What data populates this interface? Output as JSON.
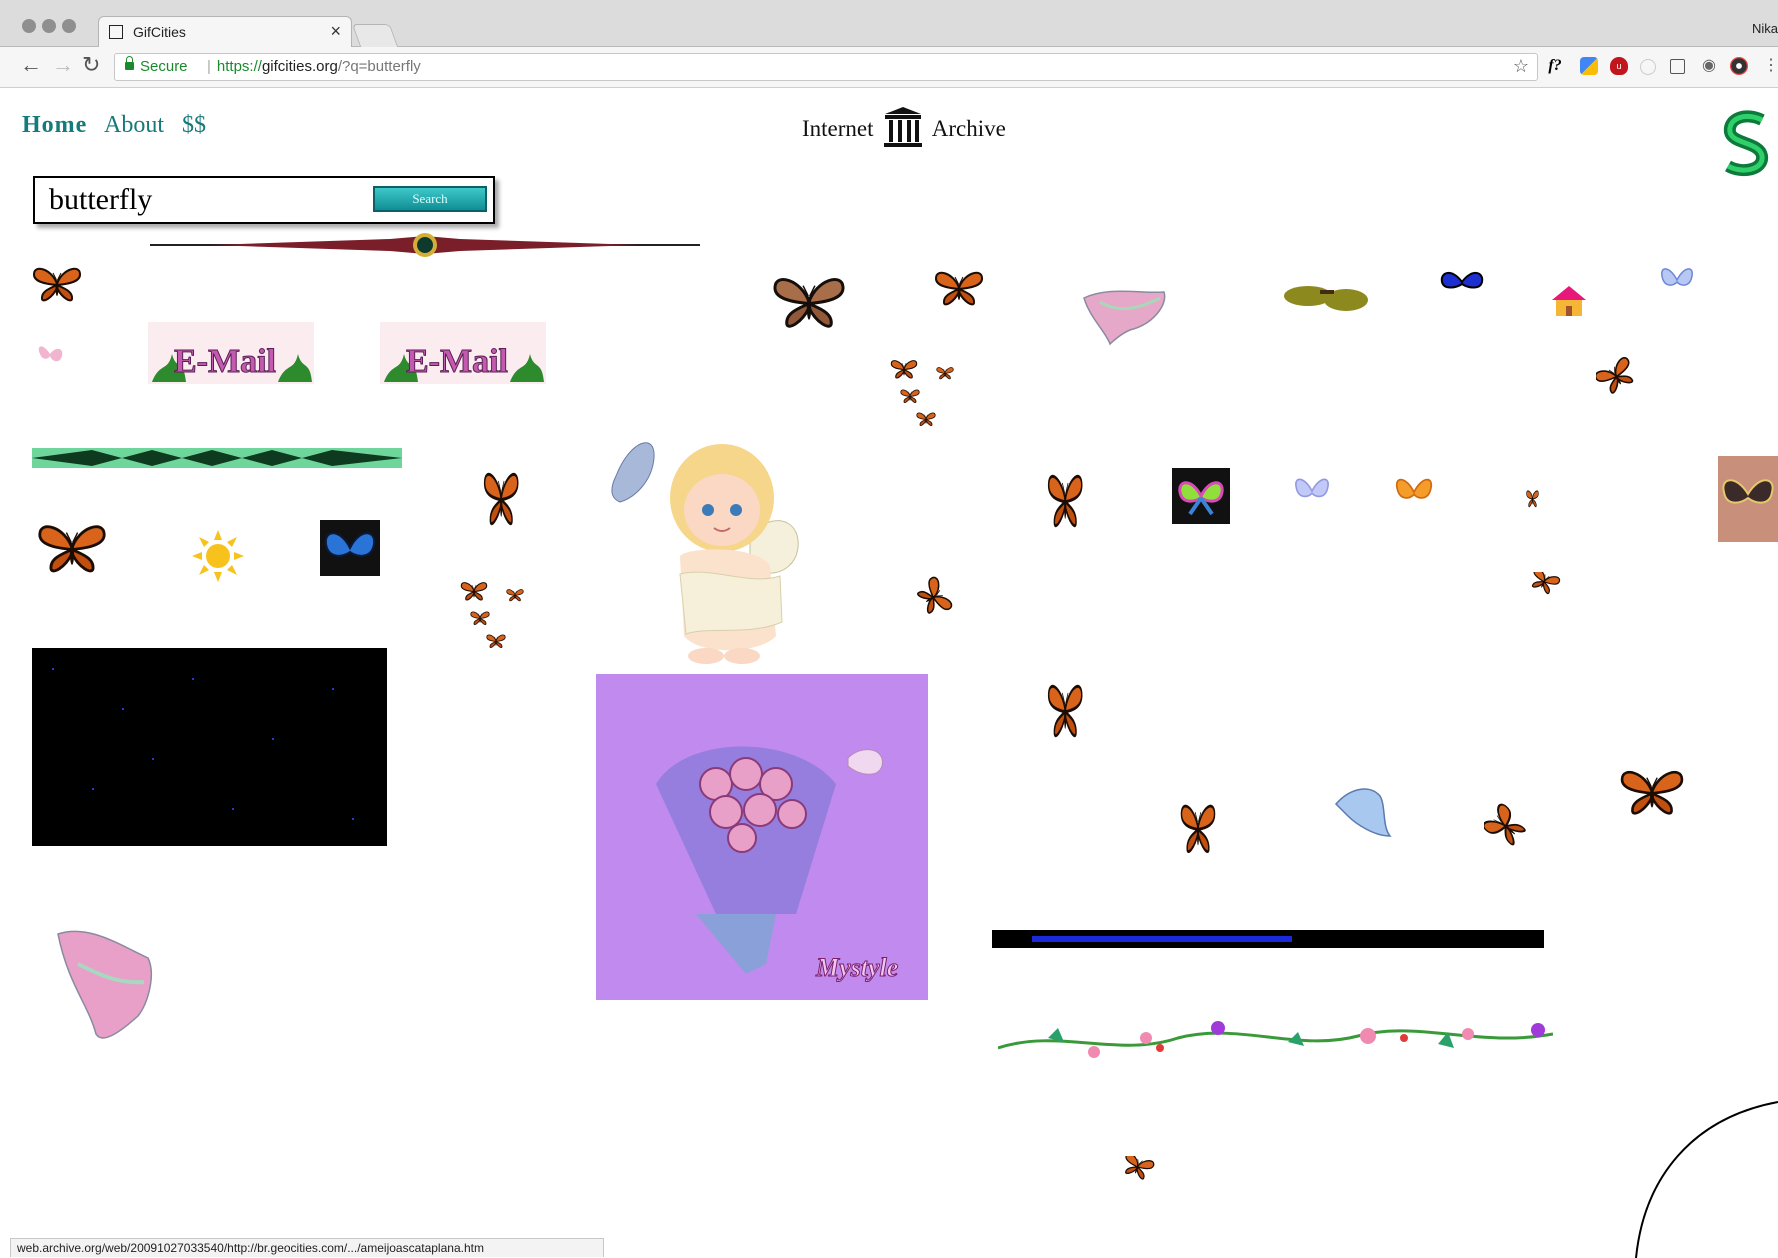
{
  "browser": {
    "tab_title": "GifCities",
    "profile": "Nika",
    "secure_label": "Secure",
    "url_scheme": "https://",
    "url_host": "gifcities.org",
    "url_path": "/?q=butterfly",
    "status_url": "web.archive.org/web/20091027033540/http://br.geocities.com/.../ameijoascataplana.htm"
  },
  "nav": {
    "home": "Home",
    "about": "About",
    "donate": "$$"
  },
  "brand": {
    "left": "Internet",
    "right": "Archive"
  },
  "search": {
    "value": "butterfly",
    "button": "Search"
  },
  "gifs": {
    "email_text": "E-Mail",
    "mystyle_text": "Mystyle"
  },
  "colors": {
    "nav": "#167a7a",
    "monarch": "#c8571a",
    "purple_bg": "#c08aee",
    "search_btn": "#1aa3a8"
  }
}
